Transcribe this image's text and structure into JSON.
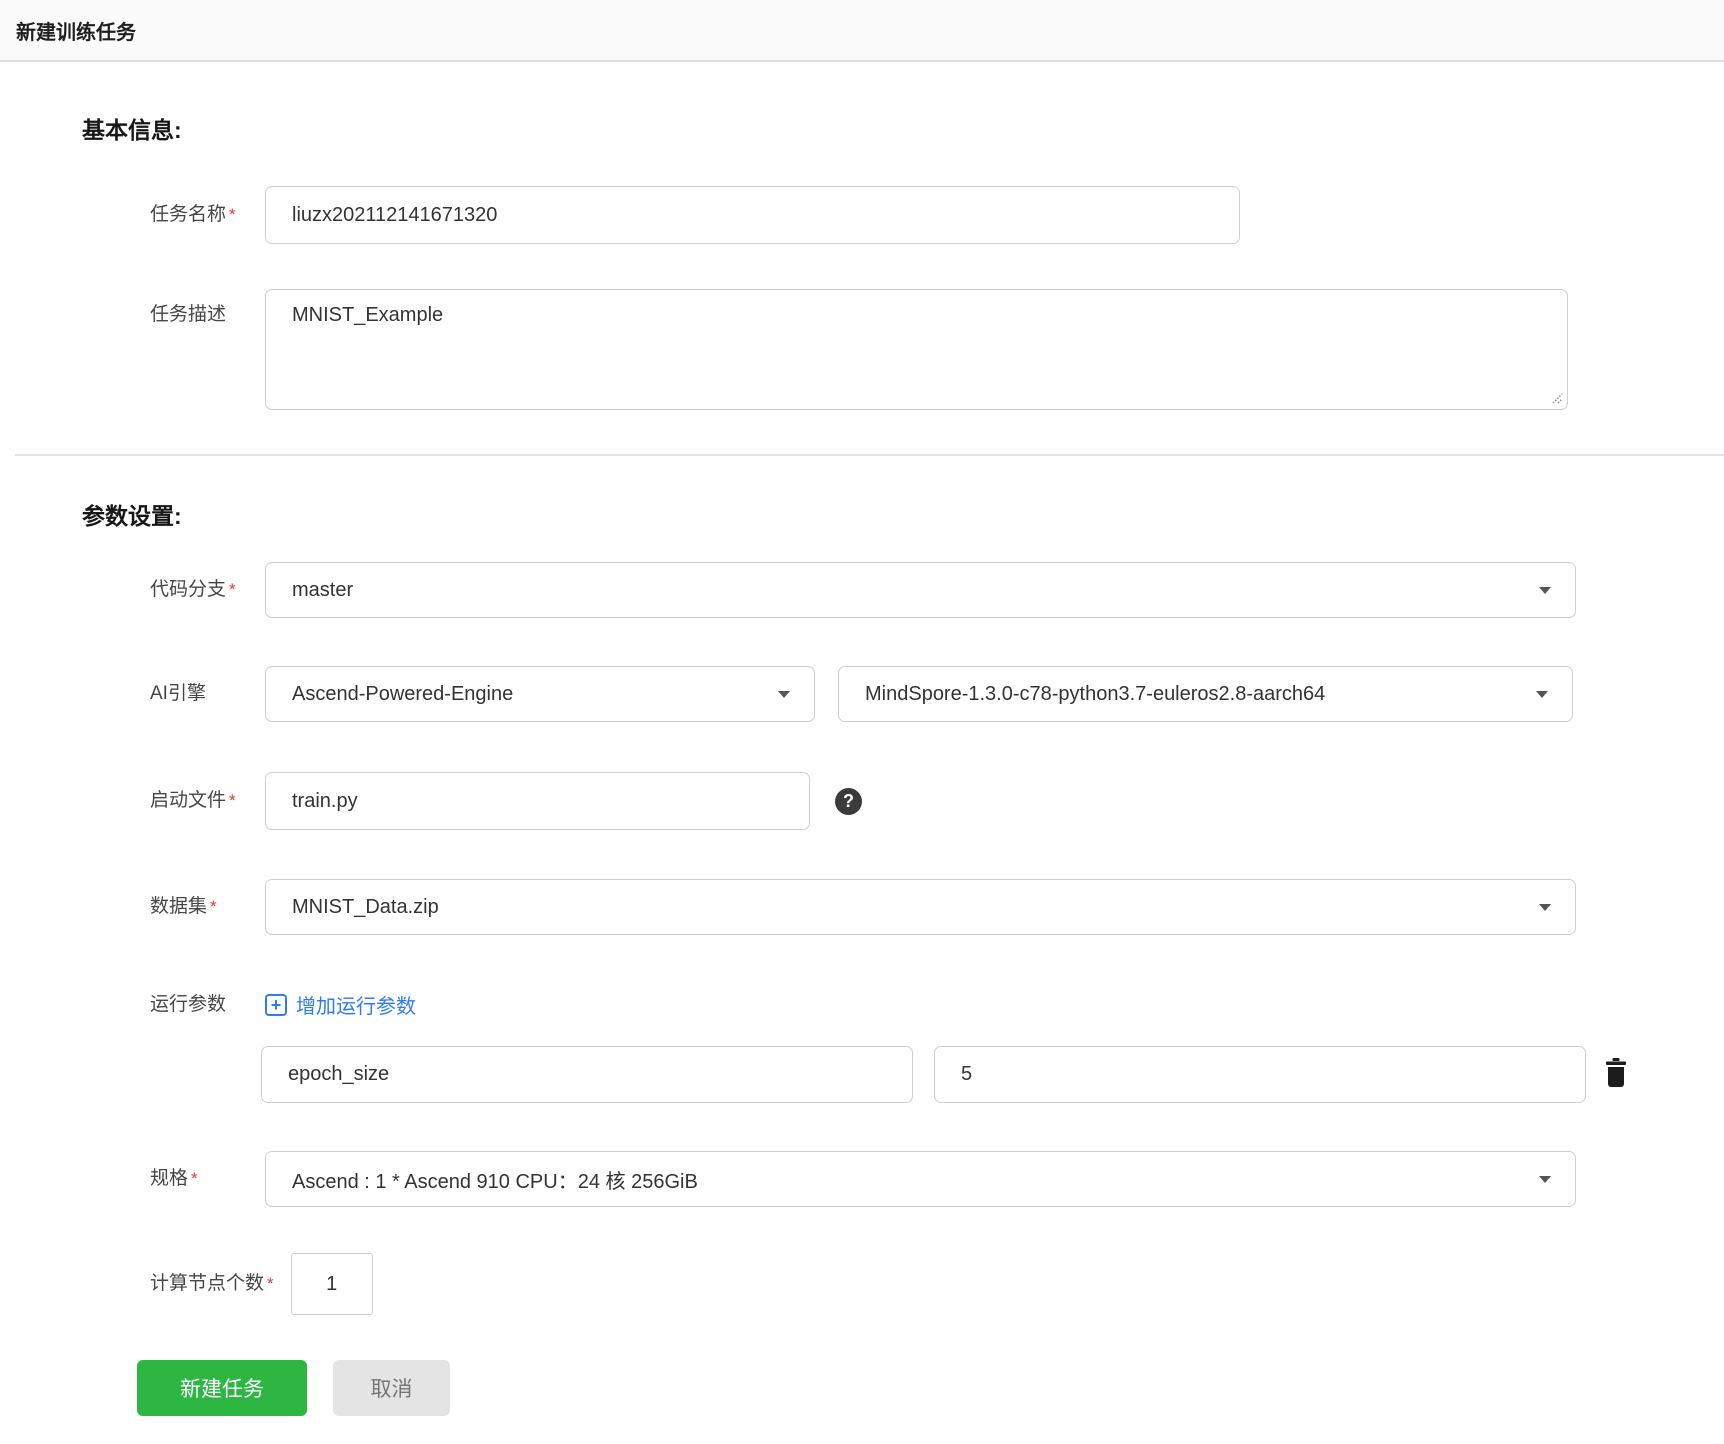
{
  "header": {
    "title": "新建训练任务"
  },
  "sections": {
    "basic_heading": "基本信息:",
    "params_heading": "参数设置:"
  },
  "ui": {
    "required_marker": "*"
  },
  "icons": {
    "help": "?",
    "add": "+"
  },
  "fields": {
    "task_name": {
      "label": "任务名称",
      "value": "liuzx202112141671320"
    },
    "task_desc": {
      "label": "任务描述",
      "value": "MNIST_Example"
    },
    "code_branch": {
      "label": "代码分支",
      "value": "master"
    },
    "ai_engine": {
      "label": "AI引擎",
      "engine_value": "Ascend-Powered-Engine",
      "version_value": "MindSpore-1.3.0-c78-python3.7-euleros2.8-aarch64"
    },
    "boot_file": {
      "label": "启动文件",
      "value": "train.py"
    },
    "dataset": {
      "label": "数据集",
      "value": "MNIST_Data.zip"
    },
    "run_params": {
      "label": "运行参数",
      "add_link": "增加运行参数",
      "rows": [
        {
          "key": "epoch_size",
          "value": "5"
        }
      ]
    },
    "spec": {
      "label": "规格",
      "value": "Ascend : 1 * Ascend 910 CPU：24 核 256GiB"
    },
    "node_count": {
      "label": "计算节点个数",
      "value": "1"
    }
  },
  "buttons": {
    "submit": "新建任务",
    "cancel": "取消"
  },
  "colors": {
    "accent_blue": "#2e7bf6",
    "primary_green": "#2db742",
    "required_red": "#e53935"
  }
}
